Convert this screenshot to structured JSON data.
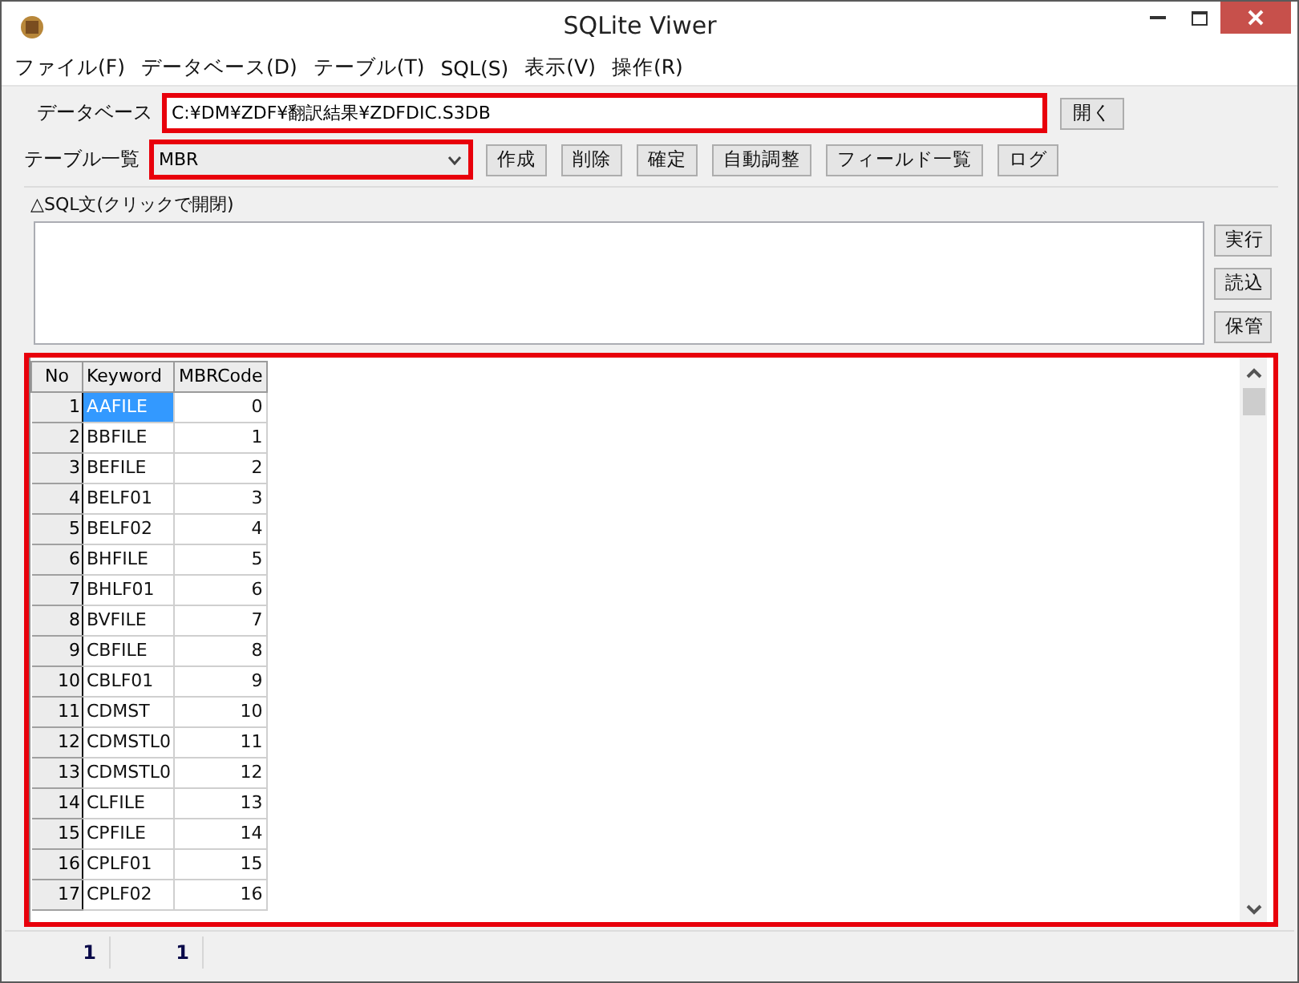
{
  "window": {
    "title": "SQLite Viwer"
  },
  "menu": [
    "ファイル(F)",
    "データベース(D)",
    "テーブル(T)",
    "SQL(S)",
    "表示(V)",
    "操作(R)"
  ],
  "database": {
    "label": "データベース",
    "value": "C:¥DM¥ZDF¥翻訳結果¥ZDFDIC.S3DB",
    "open_button": "開く"
  },
  "table_list": {
    "label": "テーブル一覧",
    "value": "MBR",
    "buttons": [
      "作成",
      "削除",
      "確定",
      "自動調整",
      "フィールド一覧",
      "ログ"
    ]
  },
  "sql": {
    "toggle_label": "△SQL文(クリックで開閉)",
    "buttons": [
      "実行",
      "読込",
      "保管"
    ]
  },
  "grid": {
    "columns": [
      "No",
      "Keyword",
      "MBRCode"
    ],
    "rows": [
      {
        "no": "1",
        "keyword": "AAFILE",
        "code": "0",
        "selected": true
      },
      {
        "no": "2",
        "keyword": "BBFILE",
        "code": "1",
        "selected": false
      },
      {
        "no": "3",
        "keyword": "BEFILE",
        "code": "2",
        "selected": false
      },
      {
        "no": "4",
        "keyword": "BELF01",
        "code": "3",
        "selected": false
      },
      {
        "no": "5",
        "keyword": "BELF02",
        "code": "4",
        "selected": false
      },
      {
        "no": "6",
        "keyword": "BHFILE",
        "code": "5",
        "selected": false
      },
      {
        "no": "7",
        "keyword": "BHLF01",
        "code": "6",
        "selected": false
      },
      {
        "no": "8",
        "keyword": "BVFILE",
        "code": "7",
        "selected": false
      },
      {
        "no": "9",
        "keyword": "CBFILE",
        "code": "8",
        "selected": false
      },
      {
        "no": "10",
        "keyword": "CBLF01",
        "code": "9",
        "selected": false
      },
      {
        "no": "11",
        "keyword": "CDMST",
        "code": "10",
        "selected": false
      },
      {
        "no": "12",
        "keyword": "CDMSTL0",
        "code": "11",
        "selected": false
      },
      {
        "no": "13",
        "keyword": "CDMSTL0",
        "code": "12",
        "selected": false
      },
      {
        "no": "14",
        "keyword": "CLFILE",
        "code": "13",
        "selected": false
      },
      {
        "no": "15",
        "keyword": "CPFILE",
        "code": "14",
        "selected": false
      },
      {
        "no": "16",
        "keyword": "CPLF01",
        "code": "15",
        "selected": false
      },
      {
        "no": "17",
        "keyword": "CPLF02",
        "code": "16",
        "selected": false
      }
    ]
  },
  "status_bar": [
    "1",
    "1"
  ]
}
